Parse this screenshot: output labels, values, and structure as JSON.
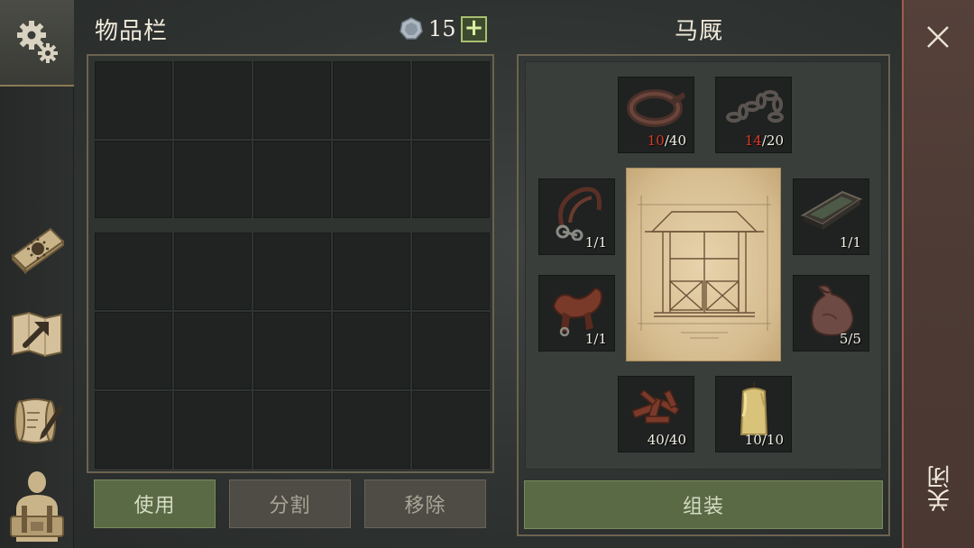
{
  "sidebar": {
    "items": [
      {
        "icon": "gear-icon"
      },
      {
        "icon": "crafting-book-icon"
      },
      {
        "icon": "building-map-icon"
      },
      {
        "icon": "quest-scroll-icon"
      },
      {
        "icon": "character-backpack-icon"
      }
    ]
  },
  "inventory": {
    "title": "物品栏",
    "coins": "15",
    "coin_icon": "silver-coin-icon",
    "add_label": "+",
    "grid_top_slots": 10,
    "grid_bottom_slots": 15
  },
  "actions": {
    "use_label": "使用",
    "split_label": "分割",
    "remove_label": "移除"
  },
  "stable": {
    "title": "马厩",
    "assemble_label": "组装",
    "materials": [
      {
        "name": "leather-belt",
        "have": "10",
        "need": "40",
        "short": true
      },
      {
        "name": "chain",
        "have": "14",
        "need": "20",
        "short": true
      },
      {
        "name": "bridle",
        "have": "1",
        "need": "1",
        "short": false
      },
      {
        "name": "feeding-trough",
        "have": "1",
        "need": "1",
        "short": false
      },
      {
        "name": "saddle",
        "have": "1",
        "need": "1",
        "short": false
      },
      {
        "name": "sack",
        "have": "5",
        "need": "5",
        "short": false
      },
      {
        "name": "copper-scraps",
        "have": "40",
        "need": "40",
        "short": false
      },
      {
        "name": "candle",
        "have": "10",
        "need": "10",
        "short": false
      }
    ]
  },
  "close": {
    "label": "关闭"
  },
  "colors": {
    "accent_green": "#5a6a45",
    "shortage_red": "#e03a2a",
    "frame_gold": "#6b6350",
    "close_border": "#a15c4a"
  }
}
